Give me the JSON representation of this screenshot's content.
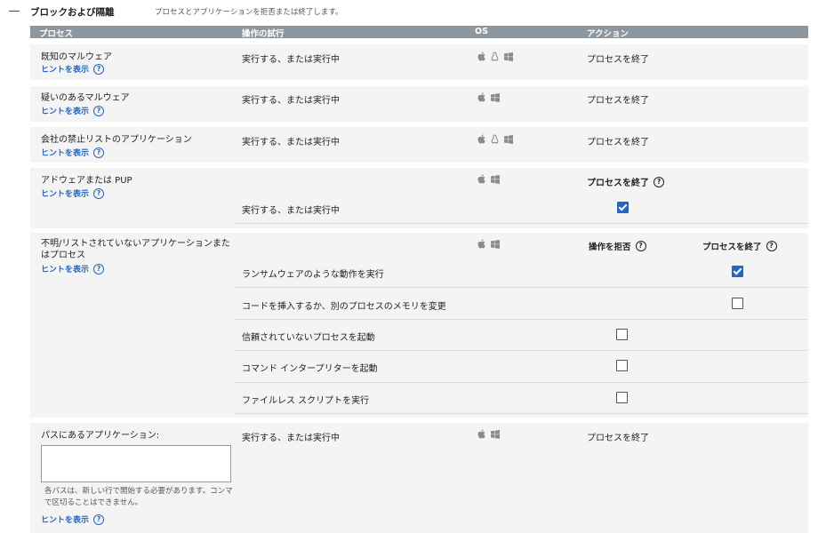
{
  "section": {
    "title": "ブロックおよび隔離",
    "description": "プロセスとアプリケーションを拒否または終了します。"
  },
  "table_headers": {
    "process": "プロセス",
    "attempt": "操作の試行",
    "os": "OS",
    "action": "アクション"
  },
  "hint_label": "ヒントを表示",
  "help_glyph": "?",
  "rows": {
    "known_malware": {
      "label": "既知のマルウェア",
      "attempt": "実行する、または実行中",
      "action": "プロセスを終了"
    },
    "suspicious_malware": {
      "label": "疑いのあるマルウェア",
      "attempt": "実行する、または実行中",
      "action": "プロセスを終了"
    },
    "company_blacklist": {
      "label": "会社の禁止リストのアプリケーション",
      "attempt": "実行する、または実行中",
      "action": "プロセスを終了"
    },
    "adware": {
      "label": "アドウェアまたは PUP",
      "attempt": "実行する、または実行中",
      "action_header": "プロセスを終了",
      "terminate_checked": true
    },
    "unknown": {
      "label_line1": "不明/リストされていないアプリケーションまた",
      "label_line2": "はプロセス",
      "deny_header": "操作を拒否",
      "terminate_header": "プロセスを終了",
      "items": [
        {
          "label": "ランサムウェアのような動作を実行",
          "terminate_checked": true
        },
        {
          "label": "コードを挿入するか、別のプロセスのメモリを変更",
          "terminate_checked": false
        },
        {
          "label": "信頼されていないプロセスを起動",
          "deny_checked": false
        },
        {
          "label": "コマンド インタープリターを起動",
          "deny_checked": false
        },
        {
          "label": "ファイルレス スクリプトを実行",
          "deny_checked": false
        }
      ]
    },
    "path_apps": {
      "label": "パスにあるアプリケーション:",
      "input_value": "",
      "note_line1": "各パスは、新しい行で開始する必要があります。コンマ",
      "note_line2": "で区切ることはできません。",
      "attempt": "実行する、または実行中",
      "action": "プロセスを終了"
    }
  },
  "colors": {
    "header_bg": "#8c979f",
    "row_bg": "#f4f4f4",
    "link": "#2366c3",
    "check": "#2366c3",
    "os_icon": "#8a8a8a"
  }
}
